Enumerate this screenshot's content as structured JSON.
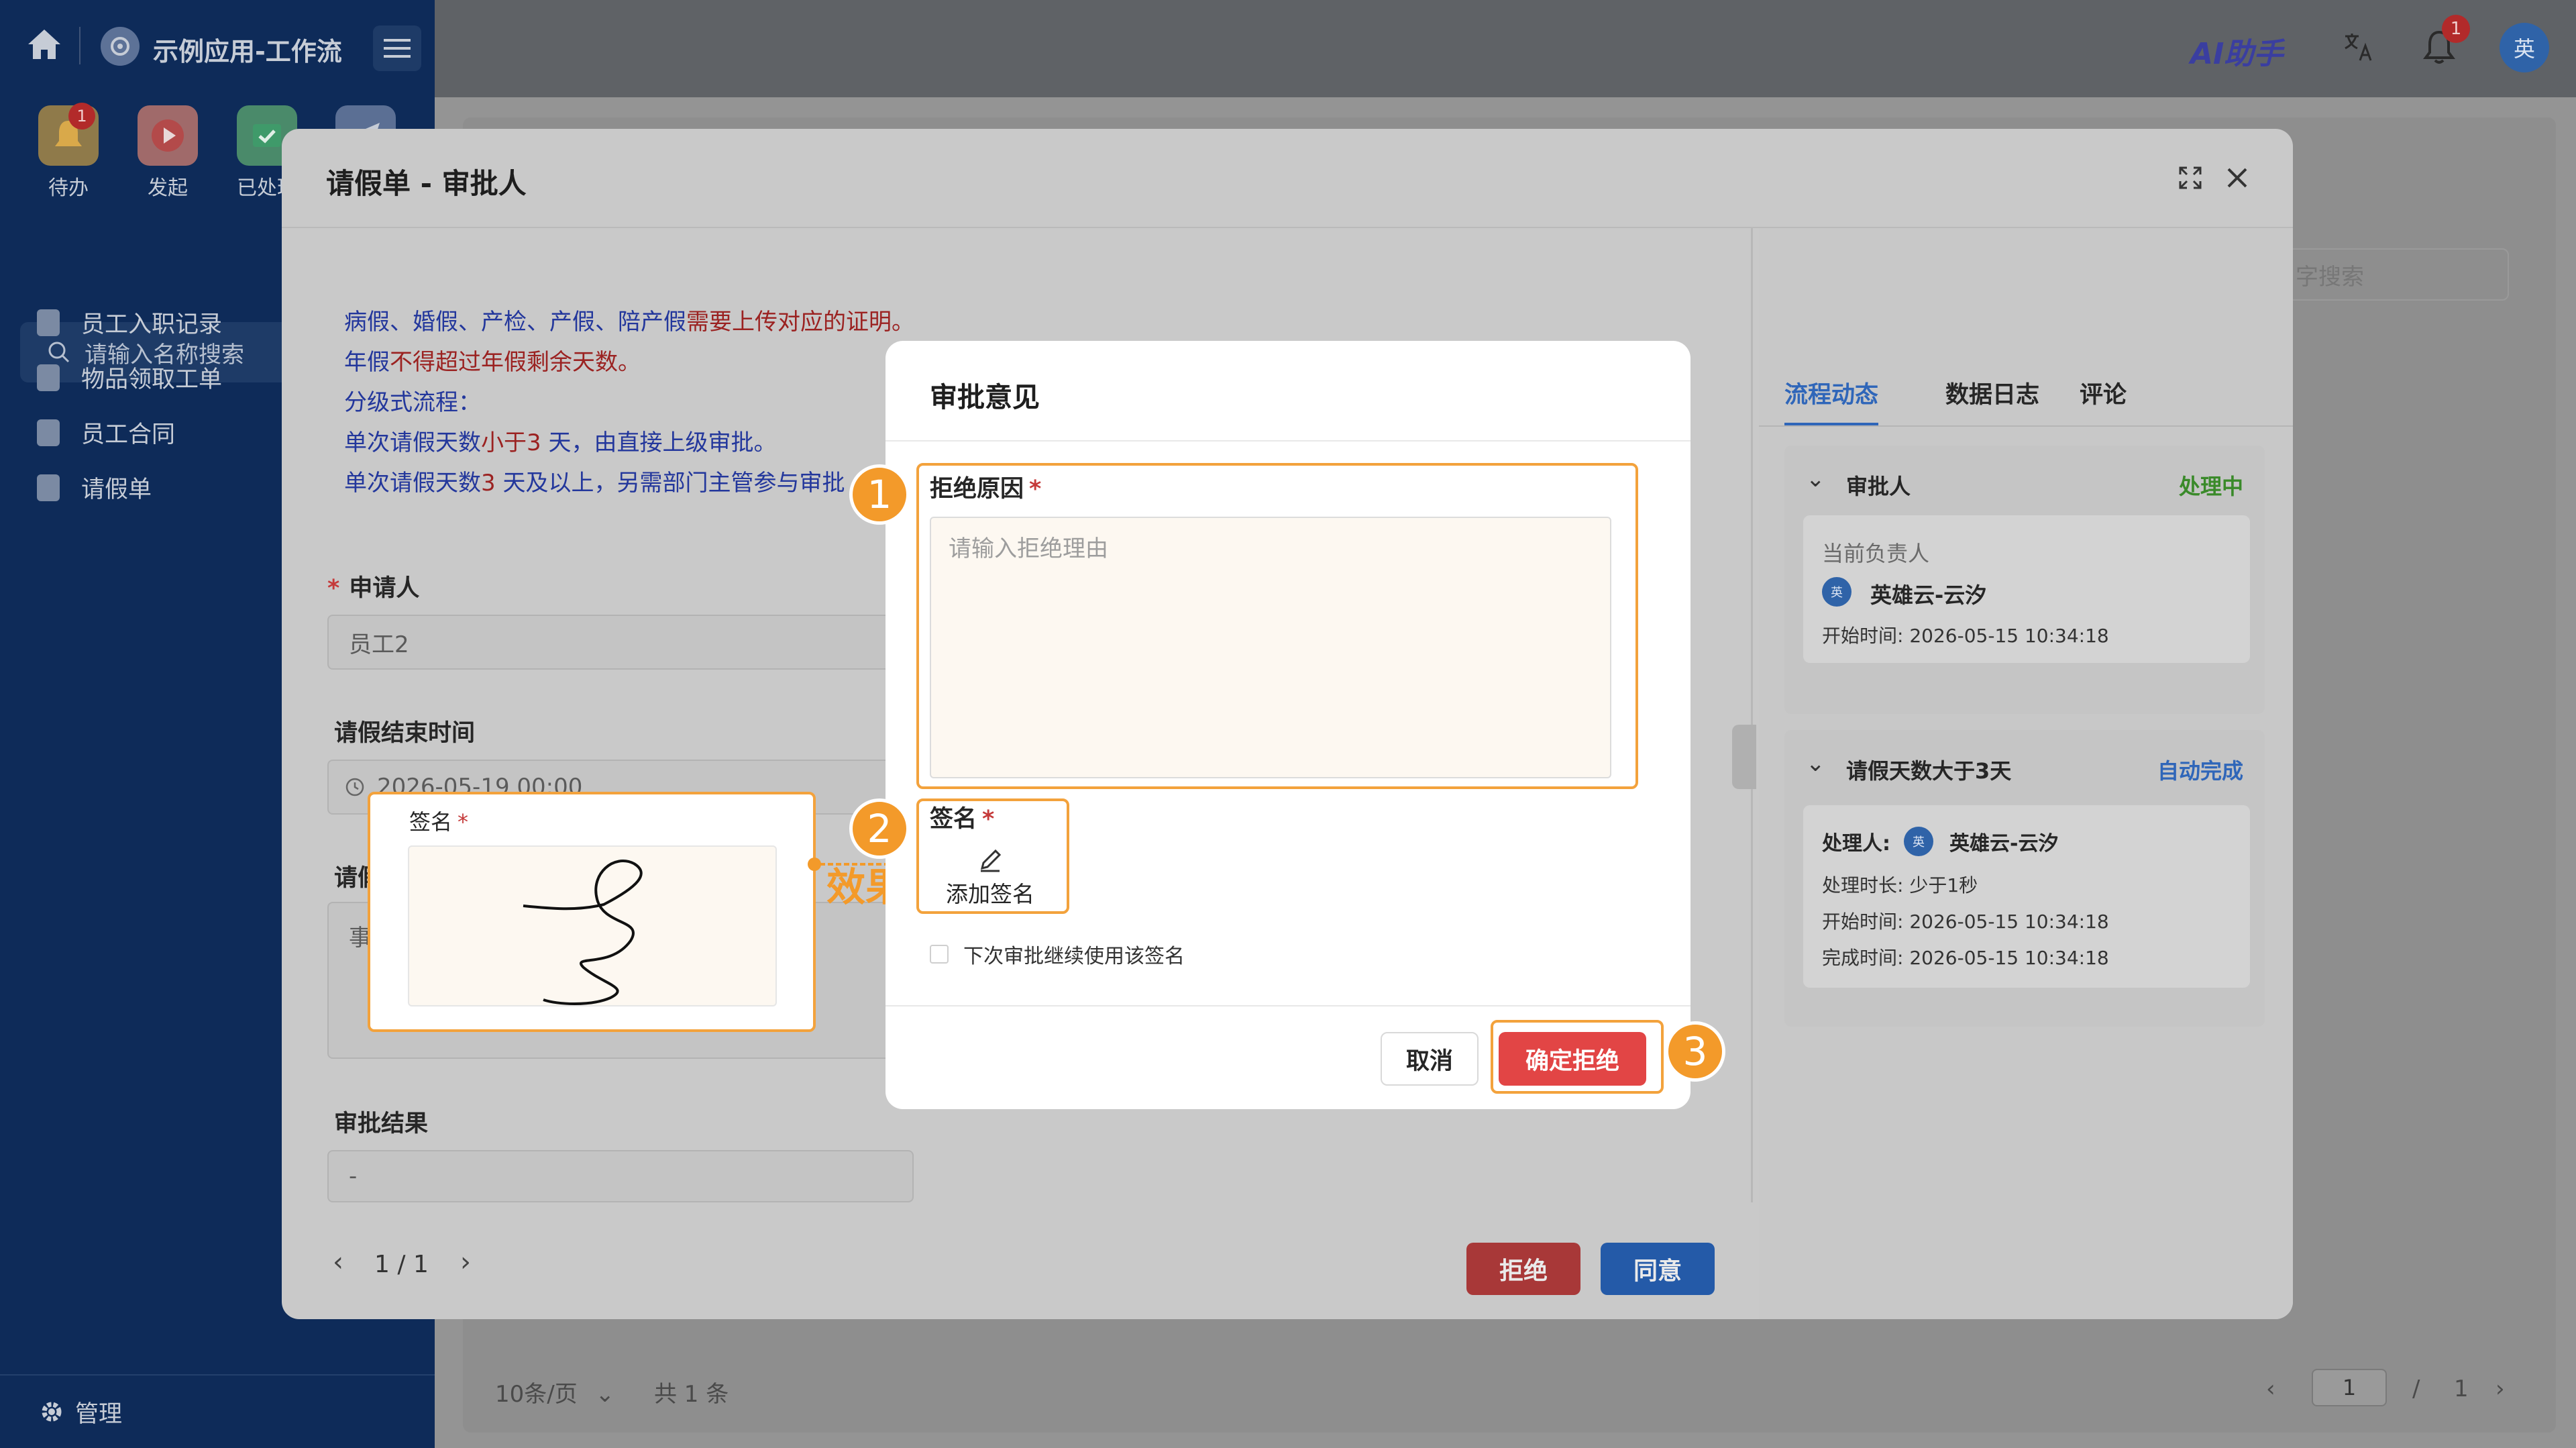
{
  "app": {
    "title": "示例应用-工作流",
    "ai_logo": "AI助手",
    "notification_count": "1",
    "user_avatar": "英"
  },
  "sidebar": {
    "quick_actions": [
      {
        "label": "待办",
        "badge": "1"
      },
      {
        "label": "发起"
      },
      {
        "label": "已处理"
      }
    ],
    "search_placeholder": "请输入名称搜索",
    "items": [
      {
        "label": "员工入职记录"
      },
      {
        "label": "物品领取工单"
      },
      {
        "label": "员工合同"
      },
      {
        "label": "请假单"
      }
    ],
    "footer_label": "管理"
  },
  "background_page": {
    "search_placeholder": "字搜索",
    "page_size": "10条/页",
    "total": "共 1 条",
    "page_current": "1",
    "page_sep": "/",
    "page_total": "1"
  },
  "form_dialog": {
    "title": "请假单 - 审批人",
    "notice": {
      "line1_a": "病假、婚假、产检、产假、陪产假",
      "line1_b": "需要上传对应的证明。",
      "line2_a": "年假",
      "line2_b": "不得超过年假剩余天数。",
      "line3": "分级式流程：",
      "line4_a": "单次请假天数",
      "line4_b": "小于3",
      "line4_c": " 天，由直接上级审批。",
      "line5_a": "单次请假天数",
      "line5_b": "3",
      "line5_c": " 天及以上，另需部门主管参与审批"
    },
    "applicant_label": "申请人",
    "applicant_value": "员工2",
    "end_time_label": "请假结束时间",
    "end_time_value": "2026-05-19 00:00",
    "reason_label_partial": "请假",
    "reason_value_partial": "事假",
    "result_label": "审批结果",
    "result_value": "-",
    "pager_current": "1",
    "pager_total": "1",
    "reject_button": "拒绝",
    "approve_button": "同意"
  },
  "right_panel": {
    "tabs": [
      {
        "label": "流程动态"
      },
      {
        "label": "数据日志"
      },
      {
        "label": "评论"
      }
    ],
    "nodes": [
      {
        "name": "审批人",
        "status": "处理中",
        "owner_label": "当前负责人",
        "owner_name": "英雄云-云汐",
        "start_label": "开始时间:",
        "start_time": "2026-05-15 10:34:18"
      },
      {
        "name": "请假天数大于3天",
        "status": "自动完成",
        "handler_label": "处理人:",
        "handler_name": "英雄云-云汐",
        "duration_label": "处理时长:",
        "duration": "少于1秒",
        "start_label": "开始时间:",
        "start_time": "2026-05-15 10:34:18",
        "finish_label": "完成时间:",
        "finish_time": "2026-05-15 10:34:18"
      }
    ]
  },
  "approval_dialog": {
    "title": "审批意见",
    "reason_label": "拒绝原因",
    "reason_placeholder": "请输入拒绝理由",
    "signature_label": "签名",
    "add_signature": "添加签名",
    "reuse_signature": "下次审批继续使用该签名",
    "cancel_button": "取消",
    "confirm_button": "确定拒绝"
  },
  "callouts": {
    "step1": "1",
    "step2": "2",
    "step3": "3",
    "effect": "效果",
    "example_signature_label": "签名"
  },
  "colors": {
    "accent_blue": "#2f66b9",
    "reject_red": "#e24545",
    "highlight_orange": "#f3a23c",
    "status_green": "#3a8a2a"
  }
}
